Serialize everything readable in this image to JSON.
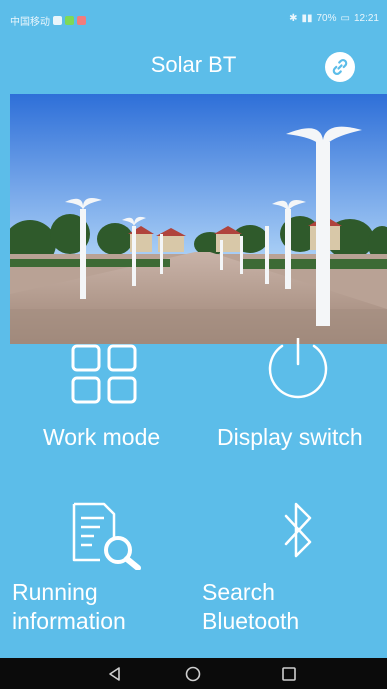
{
  "status_bar": {
    "carrier": "中国移动",
    "battery_percent": "70%",
    "time": "12:21"
  },
  "header": {
    "title": "Solar BT",
    "link_icon": "link-icon"
  },
  "banner": {
    "scene": "street-lights-photo"
  },
  "menu": {
    "work_mode": {
      "label": "Work mode",
      "icon": "grid-icon"
    },
    "display_switch": {
      "label": "Display switch",
      "icon": "power-icon"
    },
    "running_information": {
      "label_line1": "Running",
      "label_line2": "information",
      "icon": "document-search-icon"
    },
    "search_bluetooth": {
      "label_line1": "Search",
      "label_line2": "Bluetooth",
      "icon": "bluetooth-icon"
    }
  },
  "navbar": {
    "back": "back-icon",
    "home": "home-icon",
    "recents": "recents-icon"
  },
  "colors": {
    "primary": "#5cbde9",
    "navbar": "#0b0b0b",
    "text": "#ffffff"
  }
}
